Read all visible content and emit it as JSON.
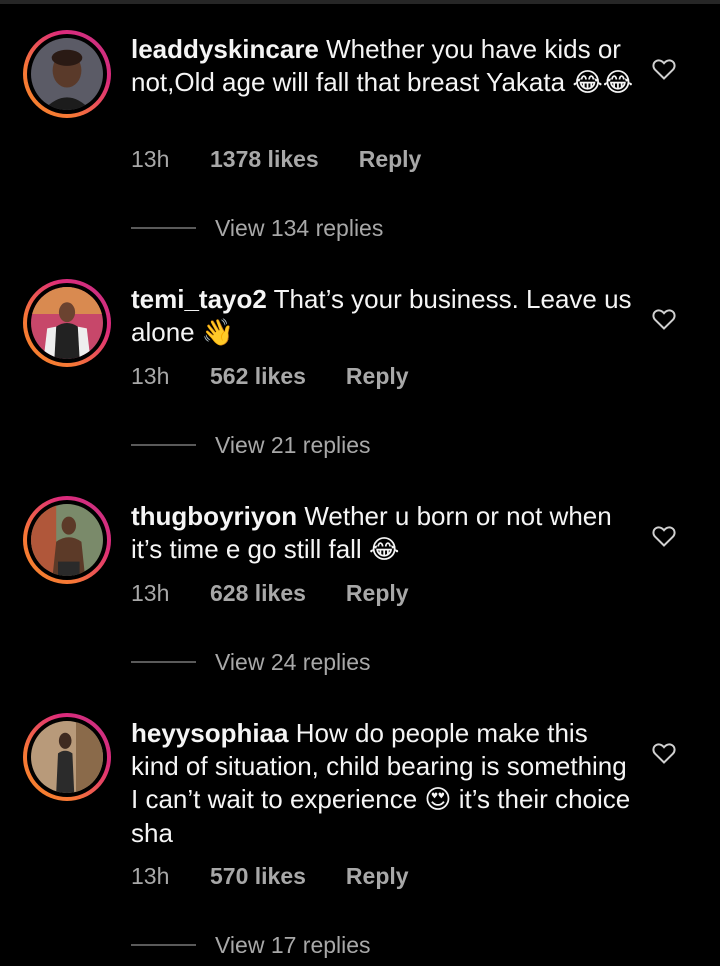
{
  "comments": [
    {
      "username": "leaddyskincare",
      "text": "Whether you have kids or not,Old age will fall that breast Yakata",
      "emoji": "😂😂",
      "time": "13h",
      "likes": "1378 likes",
      "reply_label": "Reply",
      "view_replies": "View 134 replies",
      "avatar_colors": {
        "bg": "#5b5b66",
        "skin": "#5a3a2a",
        "shirt": "#1c1c1c"
      }
    },
    {
      "username": "temi_tayo2",
      "text": "That’s your business. Leave us alone",
      "emoji": "👋",
      "time": "13h",
      "likes": "562 likes",
      "reply_label": "Reply",
      "view_replies": "View 21 replies",
      "avatar_colors": {
        "bg": "#c7476a",
        "skin": "#6b4330",
        "shirt": "#222222"
      }
    },
    {
      "username": "thugboyriyon",
      "text": "Wether u born or not when it’s time e go still fall",
      "emoji": "😂",
      "time": "13h",
      "likes": "628 likes",
      "reply_label": "Reply",
      "view_replies": "View 24 replies",
      "avatar_colors": {
        "bg": "#7a8a6a",
        "skin": "#5c3a28",
        "shirt": "#2a2a2a"
      }
    },
    {
      "username": "heyysophiaa",
      "text": "How do people make this kind of situation, child bearing is something I can’t wait to experience",
      "emoji": "😍",
      "text_after": "it’s their choice sha",
      "time": "13h",
      "likes": "570 likes",
      "reply_label": "Reply",
      "view_replies": "View 17 replies",
      "avatar_colors": {
        "bg": "#b89a7a",
        "skin": "#3e2a20",
        "shirt": "#2b2b2b"
      }
    }
  ],
  "colors": {
    "background": "#000000",
    "primary_text": "#f5f5f5",
    "secondary_text": "#a8a8a8",
    "story_ring": [
      "#f58529",
      "#dd2a7b",
      "#c13584"
    ]
  },
  "icons": {
    "like": "heart-outline-icon"
  }
}
